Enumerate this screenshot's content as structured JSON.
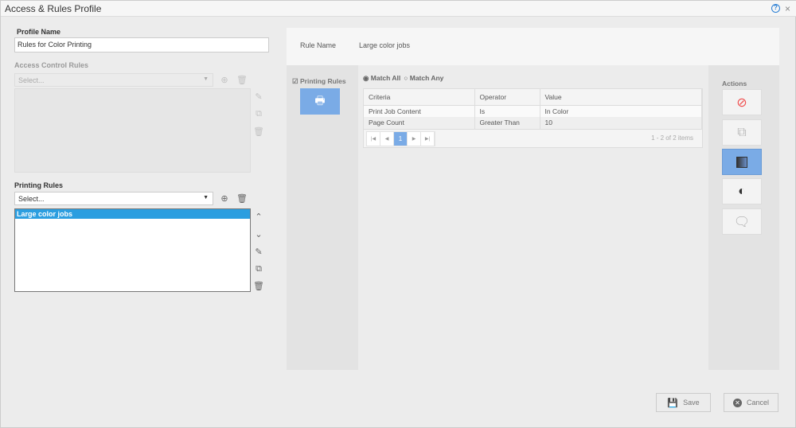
{
  "window": {
    "title": "Access & Rules Profile",
    "help": "?",
    "close": "×"
  },
  "profile": {
    "label": "Profile Name",
    "value": "Rules for Color Printing"
  },
  "access": {
    "label": "Access Control Rules",
    "placeholder": "Select..."
  },
  "printing": {
    "label": "Printing Rules",
    "placeholder": "Select...",
    "items": [
      "Large color jobs"
    ]
  },
  "rule": {
    "name_label": "Rule Name",
    "name_value": "Large color jobs",
    "section": "Printing Rules",
    "match_all": "Match All",
    "match_any": "Match Any"
  },
  "table": {
    "headers": [
      "Criteria",
      "Operator",
      "Value"
    ],
    "rows": [
      [
        "Print Job Content",
        "Is",
        "In Color"
      ],
      [
        "Page Count",
        "Greater Than",
        "10"
      ]
    ],
    "page": "1",
    "summary": "1 - 2 of 2 items"
  },
  "actions": {
    "label": "Actions"
  },
  "footer": {
    "save": "Save",
    "cancel": "Cancel"
  },
  "colors": {
    "accent": "#7aabe6",
    "selection": "#2b9ee0",
    "deny": "#f04e4e"
  }
}
